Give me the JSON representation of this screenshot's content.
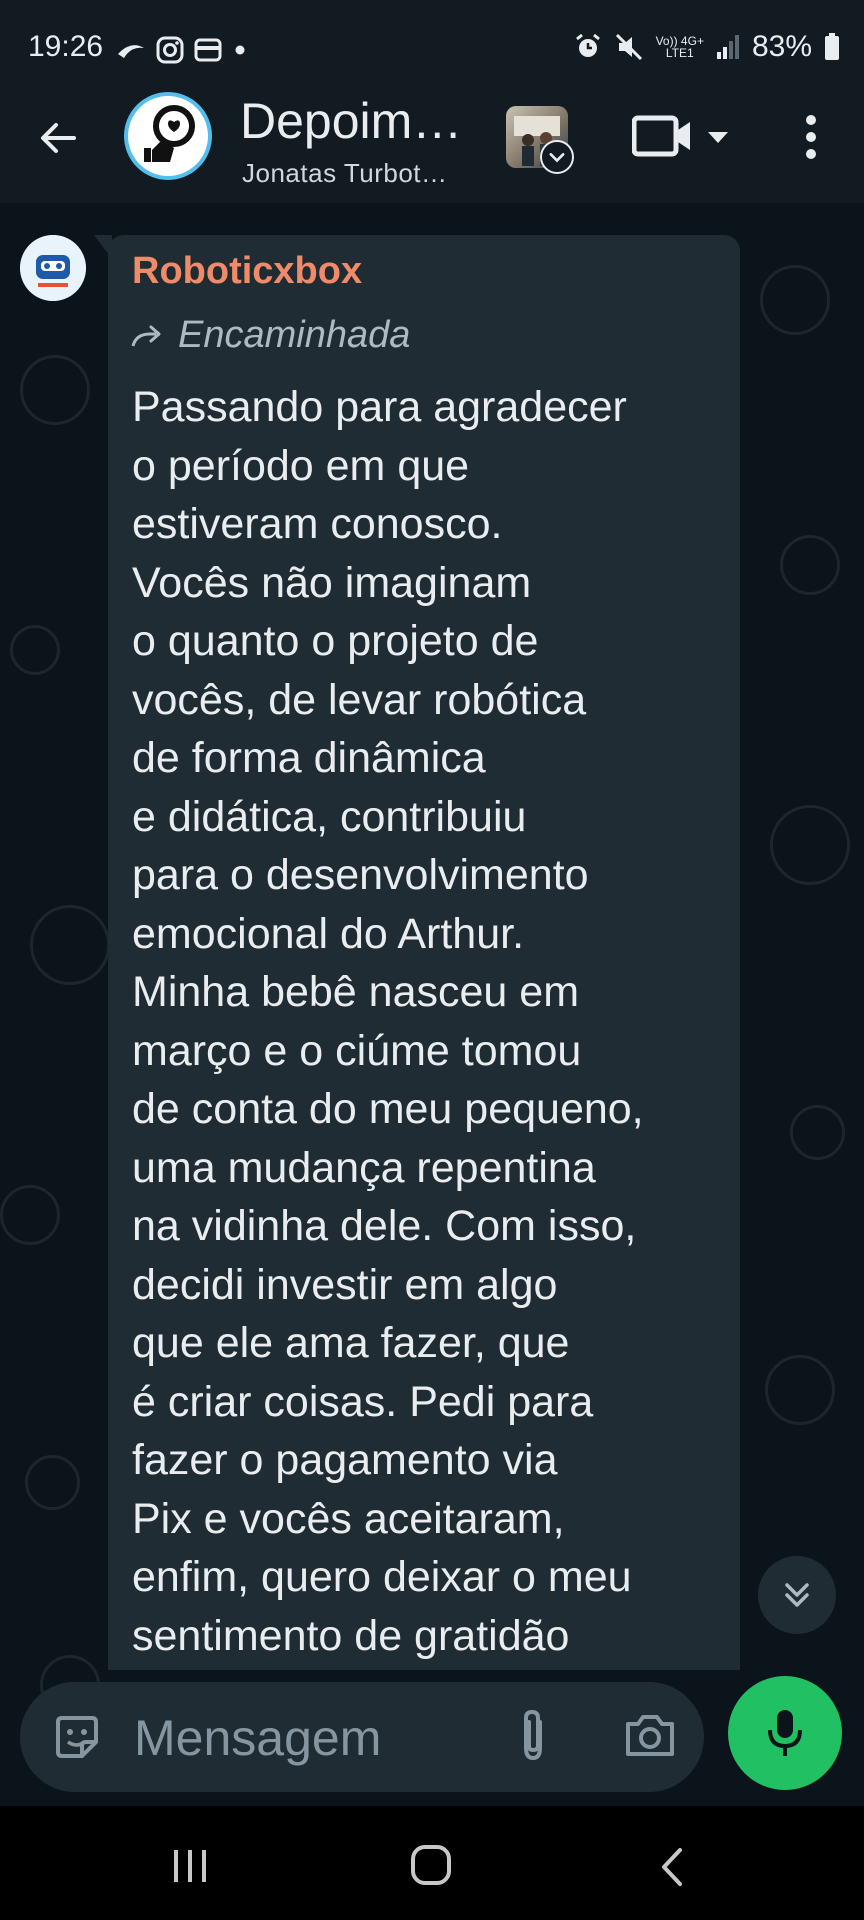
{
  "status_bar": {
    "time": "19:26",
    "battery": "83%",
    "network_top": "Vo)) 4G+",
    "network_bottom": "LTE1",
    "icons": [
      "messenger-icon",
      "instagram-icon",
      "wallet-icon",
      "dot-icon",
      "alarm-icon",
      "mute-icon",
      "signal-icon",
      "battery-icon"
    ]
  },
  "header": {
    "title": "Depoim…",
    "subtitle": "Jonatas Turbot…",
    "icons": [
      "back-arrow-icon",
      "group-avatar",
      "video-call-icon",
      "dropdown-icon",
      "more-vert-icon"
    ]
  },
  "message": {
    "sender": "Roboticxbox",
    "forwarded_label": "Encaminhada",
    "text": "Passando para agradecer\no período em que\nestiveram conosco.\nVocês não imaginam\no quanto o projeto de\nvocês, de levar robótica\nde forma dinâmica\ne  didática, contribuiu\npara o desenvolvimento\nemocional do Arthur.\nMinha bebê nasceu em\nmarço e o ciúme tomou\nde conta do meu pequeno,\numa mudança repentina\nna vidinha dele. Com isso,\ndecidi investir em algo\nque ele ama fazer, que\né criar coisas. Pedi para\nfazer o pagamento via\nPix e vocês aceitaram,\nenfim, quero deixar o meu\nsentimento de gratidão"
  },
  "composer": {
    "placeholder": "Mensagem"
  },
  "colors": {
    "app_bg": "#0b141a",
    "bar_bg": "#121b22",
    "bubble_bg": "#202c33",
    "sender_color": "#f08b6a",
    "accent_green": "#21c063"
  }
}
